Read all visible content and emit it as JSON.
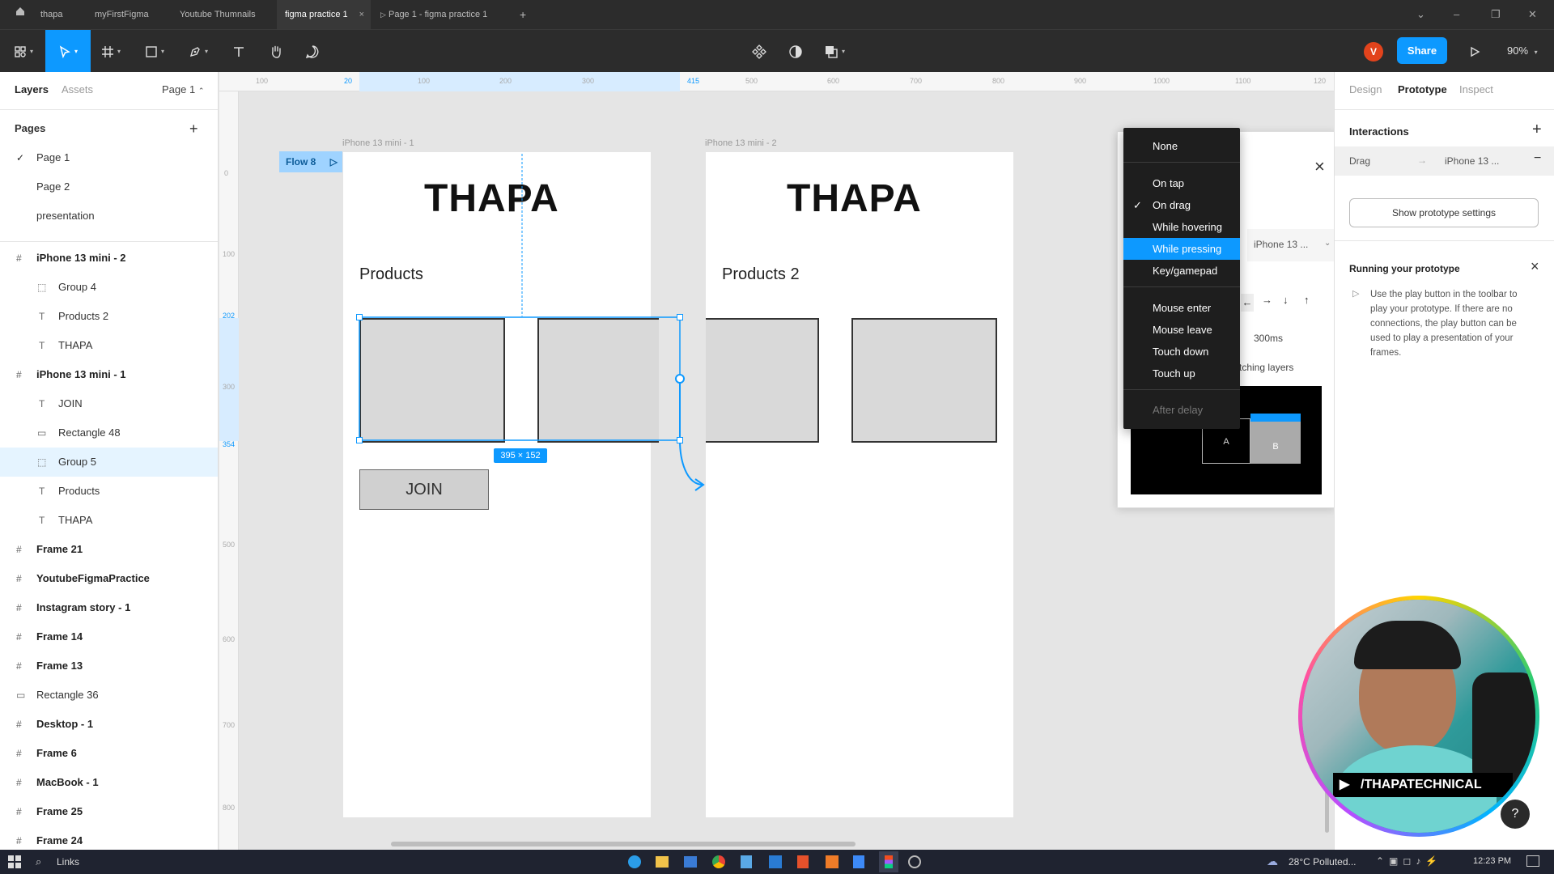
{
  "titlebar": {
    "tabs": [
      "thapa",
      "myFirstFigma",
      "Youtube Thumnails",
      "figma practice 1",
      "Page 1 - figma practice 1"
    ],
    "close_glyph": "×",
    "add_tab_glyph": "+"
  },
  "toolbar": {
    "avatar_initial": "V",
    "share_label": "Share",
    "zoom": "90%"
  },
  "left_panel": {
    "tabs": [
      "Layers",
      "Assets"
    ],
    "page_select": "Page 1",
    "pages_heading": "Pages",
    "pages": [
      "Page 1",
      "Page 2",
      "presentation"
    ],
    "layers": [
      {
        "name": "iPhone 13 mini - 2",
        "type": "frame"
      },
      {
        "name": "Group 4",
        "type": "group"
      },
      {
        "name": "Products 2",
        "type": "text"
      },
      {
        "name": "THAPA",
        "type": "text"
      },
      {
        "name": "iPhone 13 mini - 1",
        "type": "frame"
      },
      {
        "name": "JOIN",
        "type": "text"
      },
      {
        "name": "Rectangle 48",
        "type": "rect"
      },
      {
        "name": "Group 5",
        "type": "group"
      },
      {
        "name": "Products",
        "type": "text"
      },
      {
        "name": "THAPA",
        "type": "text"
      },
      {
        "name": "Frame 21",
        "type": "frame"
      },
      {
        "name": "YoutubeFigmaPractice",
        "type": "frame"
      },
      {
        "name": "Instagram story - 1",
        "type": "frame"
      },
      {
        "name": "Frame 14",
        "type": "frame"
      },
      {
        "name": "Frame 13",
        "type": "frame"
      },
      {
        "name": "Rectangle 36",
        "type": "rect"
      },
      {
        "name": "Desktop - 1",
        "type": "frame"
      },
      {
        "name": "Frame 6",
        "type": "frame"
      },
      {
        "name": "MacBook - 1",
        "type": "frame"
      },
      {
        "name": "Frame 25",
        "type": "frame"
      },
      {
        "name": "Frame 24",
        "type": "frame"
      }
    ],
    "selected_layer": "Group 5"
  },
  "canvas": {
    "hruler_ticks": [
      "100",
      "20",
      "100",
      "200",
      "300",
      "415",
      "500",
      "600",
      "700",
      "800",
      "900",
      "1000",
      "1100",
      "120"
    ],
    "vruler_ticks": [
      "0",
      "100",
      "202",
      "300",
      "354",
      "500",
      "600",
      "700",
      "800"
    ],
    "frame1": {
      "label": "iPhone 13 mini - 1",
      "title": "THAPA",
      "products": "Products",
      "join": "JOIN"
    },
    "frame2": {
      "label": "iPhone 13 mini - 2",
      "title": "THAPA",
      "products": "Products 2"
    },
    "flow_tag": "Flow 8",
    "selection_size": "395 × 152"
  },
  "interaction_popup": {
    "dest_value": "iPhone 13 ...",
    "duration": "300ms",
    "smart_animate_label": "tching layers",
    "preview_a": "A",
    "preview_b": "B",
    "close_glyph": "×"
  },
  "trigger_dropdown": {
    "items": [
      "None",
      "On tap",
      "On drag",
      "While hovering",
      "While pressing",
      "Key/gamepad",
      "Mouse enter",
      "Mouse leave",
      "Touch down",
      "Touch up",
      "After delay"
    ],
    "checked": "On drag",
    "highlighted": "While pressing",
    "disabled": "After delay"
  },
  "right_panel": {
    "tabs": [
      "Design",
      "Prototype",
      "Inspect"
    ],
    "interactions_heading": "Interactions",
    "interaction_trigger": "Drag",
    "interaction_target": "iPhone 13 ...",
    "show_settings": "Show prototype settings",
    "running_heading": "Running your prototype",
    "running_text": "Use the play button in the toolbar to play your prototype. If there are no connections, the play button can be used to play a presentation of your frames."
  },
  "taskbar": {
    "search_label": "Links",
    "weather": "28°C Polluted...",
    "time": "12:23 PM"
  },
  "webcam": {
    "channel": "/THAPATECHNICAL"
  },
  "colors": {
    "accent": "#0d99ff",
    "toolbar_bg": "#2c2c2c",
    "canvas_bg": "#e5e5e5",
    "avatar": "#e2431c"
  }
}
